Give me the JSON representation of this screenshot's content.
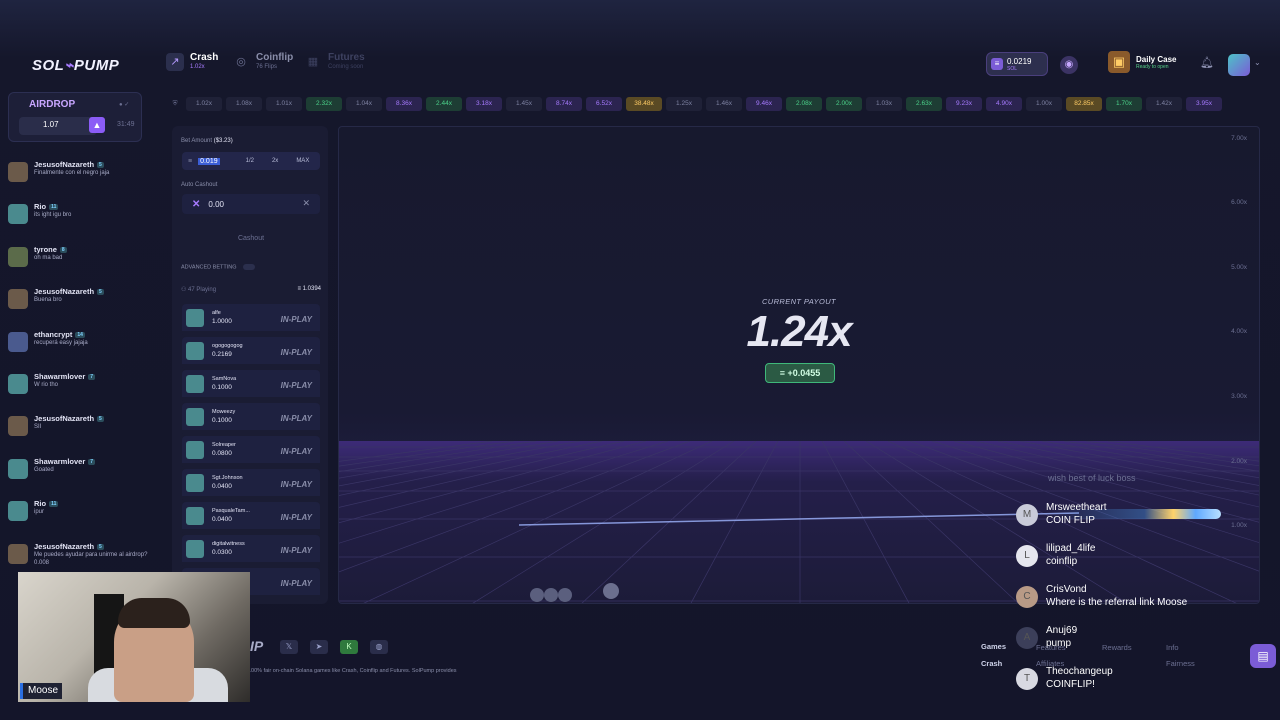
{
  "brand": {
    "logo_text": "SOL",
    "logo_mark": "⌁",
    "logo_suffix": "PUMP"
  },
  "nav": [
    {
      "label": "Crash",
      "sub": "1.02x",
      "icon": "chart-icon"
    },
    {
      "label": "Coinflip",
      "sub": "76 Flips",
      "icon": "coin-icon"
    },
    {
      "label": "Futures",
      "sub": "Coming soon",
      "icon": "futures-icon"
    }
  ],
  "wallet": {
    "amount": "0.0219",
    "currency": "SOL"
  },
  "daily_case": {
    "title": "Daily Case",
    "status": "Ready to open"
  },
  "airdrop": {
    "title": "AIRDROP",
    "value": "1.07",
    "timer": "31:49"
  },
  "history": [
    {
      "v": "1.02x",
      "c": "gray"
    },
    {
      "v": "1.08x",
      "c": "gray"
    },
    {
      "v": "1.01x",
      "c": "gray"
    },
    {
      "v": "2.32x",
      "c": "green"
    },
    {
      "v": "1.04x",
      "c": "gray"
    },
    {
      "v": "8.36x",
      "c": "purple"
    },
    {
      "v": "2.44x",
      "c": "green"
    },
    {
      "v": "3.18x",
      "c": "purple"
    },
    {
      "v": "1.45x",
      "c": "gray"
    },
    {
      "v": "8.74x",
      "c": "purple"
    },
    {
      "v": "6.52x",
      "c": "purple"
    },
    {
      "v": "38.48x",
      "c": "gold"
    },
    {
      "v": "1.25x",
      "c": "gray"
    },
    {
      "v": "1.46x",
      "c": "gray"
    },
    {
      "v": "9.46x",
      "c": "purple"
    },
    {
      "v": "2.08x",
      "c": "green"
    },
    {
      "v": "2.00x",
      "c": "green"
    },
    {
      "v": "1.03x",
      "c": "gray"
    },
    {
      "v": "2.63x",
      "c": "green"
    },
    {
      "v": "9.23x",
      "c": "purple"
    },
    {
      "v": "4.90x",
      "c": "purple"
    },
    {
      "v": "1.00x",
      "c": "gray"
    },
    {
      "v": "82.85x",
      "c": "gold"
    },
    {
      "v": "1.70x",
      "c": "green"
    },
    {
      "v": "1.42x",
      "c": "gray"
    },
    {
      "v": "3.95x",
      "c": "purple"
    }
  ],
  "chat": [
    {
      "name": "JesusofNazareth",
      "level": "5",
      "text": "Finalmente con el negro jaja"
    },
    {
      "name": "Rio",
      "level": "11",
      "text": "its ight igu bro"
    },
    {
      "name": "tyrone",
      "level": "8",
      "text": "oh ma bad"
    },
    {
      "name": "JesusofNazareth",
      "level": "5",
      "text": "Buena bro"
    },
    {
      "name": "ethancrypt",
      "level": "14",
      "text": "recuperá easy jajaja"
    },
    {
      "name": "Shawarmlover",
      "level": "7",
      "text": "W rio tho"
    },
    {
      "name": "JesusofNazareth",
      "level": "5",
      "text": "SII"
    },
    {
      "name": "Shawarmlover",
      "level": "7",
      "text": "Goated"
    },
    {
      "name": "Rio",
      "level": "11",
      "text": "ipur"
    },
    {
      "name": "JesusofNazareth",
      "level": "5",
      "text": "Me puedes ayudar para unirme al airdrop? 0.008"
    }
  ],
  "bet": {
    "amount_label": "Bet Amount",
    "amount_usd": "($3.23)",
    "amount_value": "0.019",
    "half": "1/2",
    "double": "2x",
    "max": "MAX",
    "auto_label": "Auto Cashout",
    "auto_value": "0.00",
    "cashout_button": "Cashout",
    "advanced": "ADVANCED BETTING",
    "playing": "47 Playing",
    "pot": "1.0394"
  },
  "players": [
    {
      "name": "alfe",
      "amount": "1.0000",
      "status": "IN-PLAY"
    },
    {
      "name": "ogogogogog",
      "amount": "0.2169",
      "status": "IN-PLAY"
    },
    {
      "name": "SamNova",
      "amount": "0.1000",
      "status": "IN-PLAY"
    },
    {
      "name": "Moweezy",
      "amount": "0.1000",
      "status": "IN-PLAY"
    },
    {
      "name": "Solreaper",
      "amount": "0.0800",
      "status": "IN-PLAY"
    },
    {
      "name": "Sgt.Johnson",
      "amount": "0.0400",
      "status": "IN-PLAY"
    },
    {
      "name": "PasqualeTam...",
      "amount": "0.0400",
      "status": "IN-PLAY"
    },
    {
      "name": "digitalwitness",
      "amount": "0.0300",
      "status": "IN-PLAY"
    },
    {
      "name": "",
      "amount": "",
      "status": "IN-PLAY"
    }
  ],
  "game": {
    "payout_label": "CURRENT PAYOUT",
    "payout": "1.24x",
    "profit": "+0.0455",
    "y_ticks": [
      "7.00x",
      "6.00x",
      "5.00x",
      "4.00x",
      "3.00x",
      "2.00x",
      "1.00x"
    ]
  },
  "overlay_chat": {
    "faint": "wish best of luck boss",
    "messages": [
      {
        "initial": "M",
        "name": "Mrsweetheart",
        "text": "COIN FLIP"
      },
      {
        "initial": "L",
        "name": "lilipad_4life",
        "text": "coinflip"
      },
      {
        "initial": "C",
        "name": "CrisVond",
        "text": "Where is the referral link Moose"
      },
      {
        "initial": "A",
        "name": "Anuj69",
        "text": "pump"
      },
      {
        "initial": "T",
        "name": "Theochangeup",
        "text": "COINFLIP!"
      }
    ]
  },
  "footer": {
    "logo": "IP",
    "tagline": "100% fair on-chain Solana games like Crash, Coinflip and Futures. SolPump provides",
    "games": "Games",
    "crash": "Crash",
    "rewards": "Rewards",
    "info": "Info",
    "fairness": "Fairness",
    "features": "Features",
    "affiliates": "Affiliates"
  },
  "streamer": {
    "name": "Moose"
  },
  "colors": {
    "accent": "#a77bff",
    "green": "#4cd38a",
    "gold": "#ffcc66",
    "bg": "#14152a"
  }
}
